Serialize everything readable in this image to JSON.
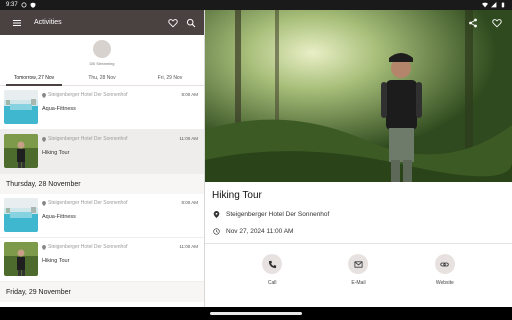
{
  "status_bar": {
    "time": "9:37"
  },
  "app_bar": {
    "title": "Activities"
  },
  "streaming": {
    "label": "DB Streaming"
  },
  "tabs": [
    {
      "label": "Tomorrow, 27 Nov",
      "active": true
    },
    {
      "label": "Thu, 28 Nov",
      "active": false
    },
    {
      "label": "Fri, 29 Nov",
      "active": false
    }
  ],
  "list": {
    "sections": [
      {
        "items": [
          {
            "location": "Steigenberger Hotel Der Sonnenhof",
            "title": "Aqua-Fittness",
            "time": "8:00 AM",
            "thumb": "pool",
            "selected": false
          },
          {
            "location": "Steigenberger Hotel Der Sonnenhof",
            "title": "Hiking Tour",
            "time": "11:00 AM",
            "thumb": "hiker",
            "selected": true
          }
        ]
      },
      {
        "header": "Thursday, 28 November",
        "items": [
          {
            "location": "Steigenberger Hotel Der Sonnenhof",
            "title": "Aqua-Fittness",
            "time": "8:00 AM",
            "thumb": "pool",
            "selected": false
          },
          {
            "location": "Steigenberger Hotel Der Sonnenhof",
            "title": "Hiking Tour",
            "time": "11:00 AM",
            "thumb": "hiker",
            "selected": false
          }
        ]
      },
      {
        "header": "Friday, 29 November",
        "items": []
      }
    ]
  },
  "detail": {
    "title": "Hiking Tour",
    "location": "Steigenberger Hotel Der Sonnenhof",
    "datetime": "Nov 27, 2024 11:00 AM",
    "contacts": [
      {
        "label": "Call",
        "icon": "phone-icon"
      },
      {
        "label": "E-Mail",
        "icon": "mail-icon"
      },
      {
        "label": "Website",
        "icon": "link-icon"
      }
    ]
  },
  "colors": {
    "app_bar": "#4a4240",
    "selected_row": "#efedec",
    "contact_button": "#e7e2e0"
  }
}
